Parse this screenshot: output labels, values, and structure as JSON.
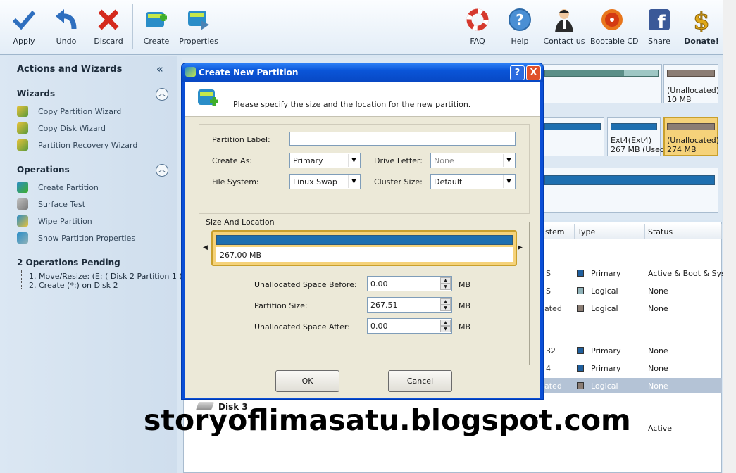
{
  "toolbar": {
    "apply": "Apply",
    "undo": "Undo",
    "discard": "Discard",
    "create": "Create",
    "properties": "Properties",
    "faq": "FAQ",
    "help": "Help",
    "contact": "Contact us",
    "bootable": "Bootable CD",
    "share": "Share",
    "donate": "Donate!"
  },
  "left_panel": {
    "title": "Actions and Wizards",
    "wizards_title": "Wizards",
    "wizards": [
      "Copy Partition Wizard",
      "Copy Disk Wizard",
      "Partition Recovery Wizard"
    ],
    "operations_title": "Operations",
    "operations": [
      "Create Partition",
      "Surface Test",
      "Wipe Partition",
      "Show Partition Properties"
    ],
    "pending_title": "2 Operations Pending",
    "pending": [
      "1. Move/Resize: (E: ( Disk 2 Partition 1 ))",
      "2. Create (*:) on Disk 2"
    ]
  },
  "disk_map": {
    "row1_unalloc_label": "(Unallocated)",
    "row1_unalloc_size": "10 MB",
    "row2_ext4_label": "Ext4(Ext4)",
    "row2_ext4_size": "267 MB (Used",
    "row2_unalloc_label": "(Unallocated)",
    "row2_unalloc_size": "274 MB"
  },
  "table": {
    "columns": [
      "stem",
      "Type",
      "Status"
    ],
    "rows": [
      {
        "fs": "S",
        "type": "Primary",
        "status": "Active & Boot & Syst",
        "color": "#1f5f9e"
      },
      {
        "fs": "S",
        "type": "Logical",
        "status": "None",
        "color": "#8fb2b8"
      },
      {
        "fs": "ated",
        "type": "Logical",
        "status": "None",
        "color": "#8b7d74"
      },
      {
        "fs": "32",
        "type": "Primary",
        "status": "None",
        "color": "#1f5f9e"
      },
      {
        "fs": "4",
        "type": "Primary",
        "status": "None",
        "color": "#1f5f9e"
      },
      {
        "fs": "ated",
        "type": "Logical",
        "status": "None",
        "color": "#8b7d74"
      }
    ],
    "disk3_label": "Disk 3",
    "disk3_status": "Active"
  },
  "dialog": {
    "title": "Create New Partition",
    "help_btn": "?",
    "close_btn": "X",
    "intro": "Please specify the size and the location for the new partition.",
    "partition_label_lbl": "Partition Label:",
    "partition_label_val": "",
    "create_as_lbl": "Create As:",
    "create_as_val": "Primary",
    "drive_letter_lbl": "Drive Letter:",
    "drive_letter_val": "None",
    "file_system_lbl": "File System:",
    "file_system_val": "Linux Swap",
    "cluster_size_lbl": "Cluster Size:",
    "cluster_size_val": "Default",
    "size_group": "Size And Location",
    "bar_text": "267.00 MB",
    "unalloc_before_lbl": "Unallocated Space Before:",
    "unalloc_before_val": "0.00",
    "partition_size_lbl": "Partition Size:",
    "partition_size_val": "267.51",
    "unalloc_after_lbl": "Unallocated Space After:",
    "unalloc_after_val": "0.00",
    "unit": "MB",
    "ok": "OK",
    "cancel": "Cancel"
  },
  "watermark": "storyoflimasatu.blogspot.com"
}
